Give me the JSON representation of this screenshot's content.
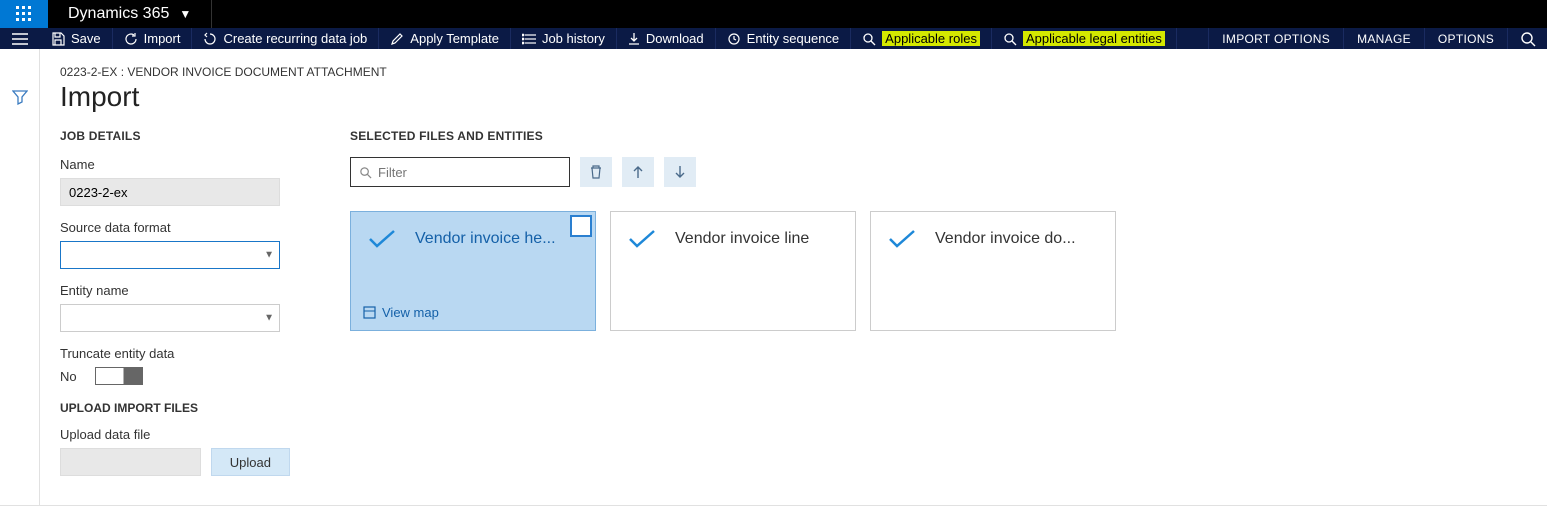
{
  "brand": {
    "title": "Dynamics 365"
  },
  "actions": {
    "save": "Save",
    "import": "Import",
    "recurring": "Create recurring data job",
    "applyTemplate": "Apply Template",
    "jobHistory": "Job history",
    "download": "Download",
    "entitySequence": "Entity sequence",
    "applicableRoles": "Applicable roles",
    "applicableLegal": "Applicable legal entities",
    "importOptions": "IMPORT OPTIONS",
    "manage": "MANAGE",
    "options": "OPTIONS"
  },
  "page": {
    "breadcrumb": "0223-2-EX : VENDOR INVOICE DOCUMENT ATTACHMENT",
    "title": "Import"
  },
  "jobDetails": {
    "header": "JOB DETAILS",
    "nameLabel": "Name",
    "nameValue": "0223-2-ex",
    "sourceLabel": "Source data format",
    "sourceValue": "",
    "entityLabel": "Entity name",
    "entityValue": "",
    "truncateLabel": "Truncate entity data",
    "truncateValue": "No",
    "uploadHeader": "UPLOAD IMPORT FILES",
    "uploadLabel": "Upload data file",
    "uploadBtn": "Upload"
  },
  "selectedFiles": {
    "header": "SELECTED FILES AND ENTITIES",
    "filterPlaceholder": "Filter",
    "viewMap": "View map",
    "cards": [
      {
        "title": "Vendor invoice he...",
        "selected": true
      },
      {
        "title": "Vendor invoice line",
        "selected": false
      },
      {
        "title": "Vendor invoice do...",
        "selected": false
      }
    ]
  }
}
